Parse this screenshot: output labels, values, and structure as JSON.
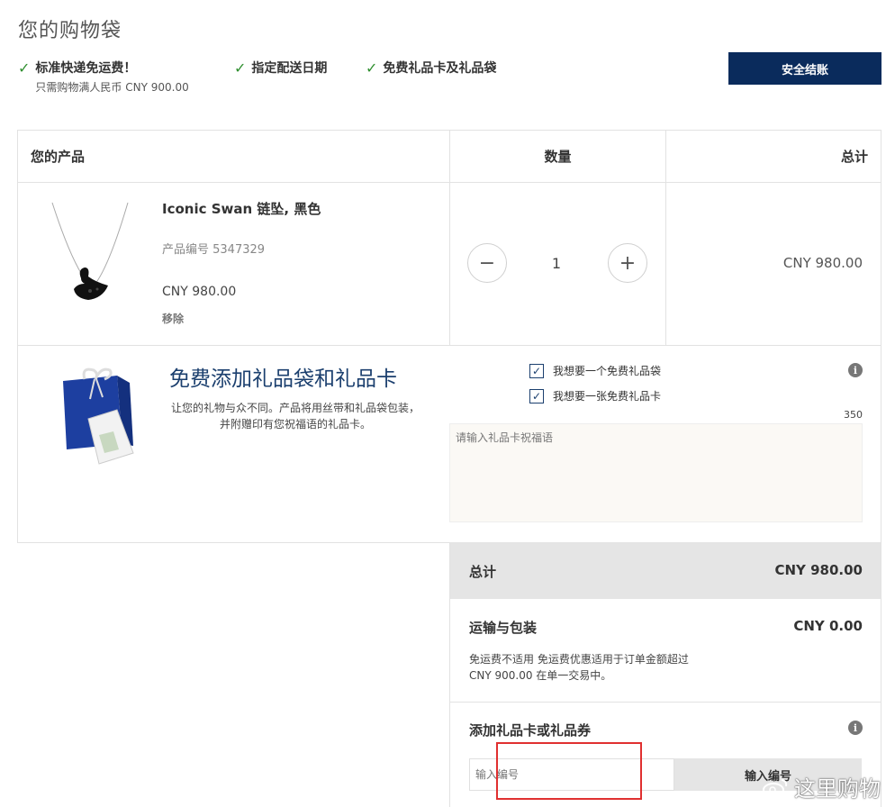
{
  "page_title": "您的购物袋",
  "benefits": [
    {
      "title": "标准快递免运费！",
      "subtitle": "只需购物满人民币 CNY 900.00"
    },
    {
      "title": "指定配送日期",
      "subtitle": ""
    },
    {
      "title": "免费礼品卡及礼品袋",
      "subtitle": ""
    }
  ],
  "checkout_button": "安全结账",
  "table": {
    "headers": {
      "product": "您的产品",
      "quantity": "数量",
      "total": "总计"
    },
    "item": {
      "name": "Iconic Swan 链坠, 黑色",
      "sku": "产品编号 5347329",
      "price": "CNY 980.00",
      "remove": "移除",
      "quantity": "1",
      "line_total": "CNY 980.00"
    }
  },
  "gift": {
    "title": "免费添加礼品袋和礼品卡",
    "description_line1": "让您的礼物与众不同。产品将用丝带和礼品袋包装，",
    "description_line2": "并附赠印有您祝福语的礼品卡。",
    "option_bag": "我想要一个免费礼品袋",
    "option_card": "我想要一张免费礼品卡",
    "char_limit": "350",
    "message_placeholder": "请输入礼品卡祝福语"
  },
  "summary": {
    "total_label": "总计",
    "total_value": "CNY 980.00",
    "shipping_label": "运输与包装",
    "shipping_value": "CNY 0.00",
    "shipping_note_line1": "免运费不适用 免运费优惠适用于订单金额超过",
    "shipping_note_line2": "CNY 900.00 在单一交易中。",
    "gift_card_label": "添加礼品卡或礼品券",
    "code_placeholder": "输入编号",
    "code_button": "输入编号"
  },
  "watermark": "这里购物",
  "colors": {
    "brand_navy": "#0a2b5c",
    "check_green": "#2f8f2f",
    "highlight_red": "#e03030"
  }
}
